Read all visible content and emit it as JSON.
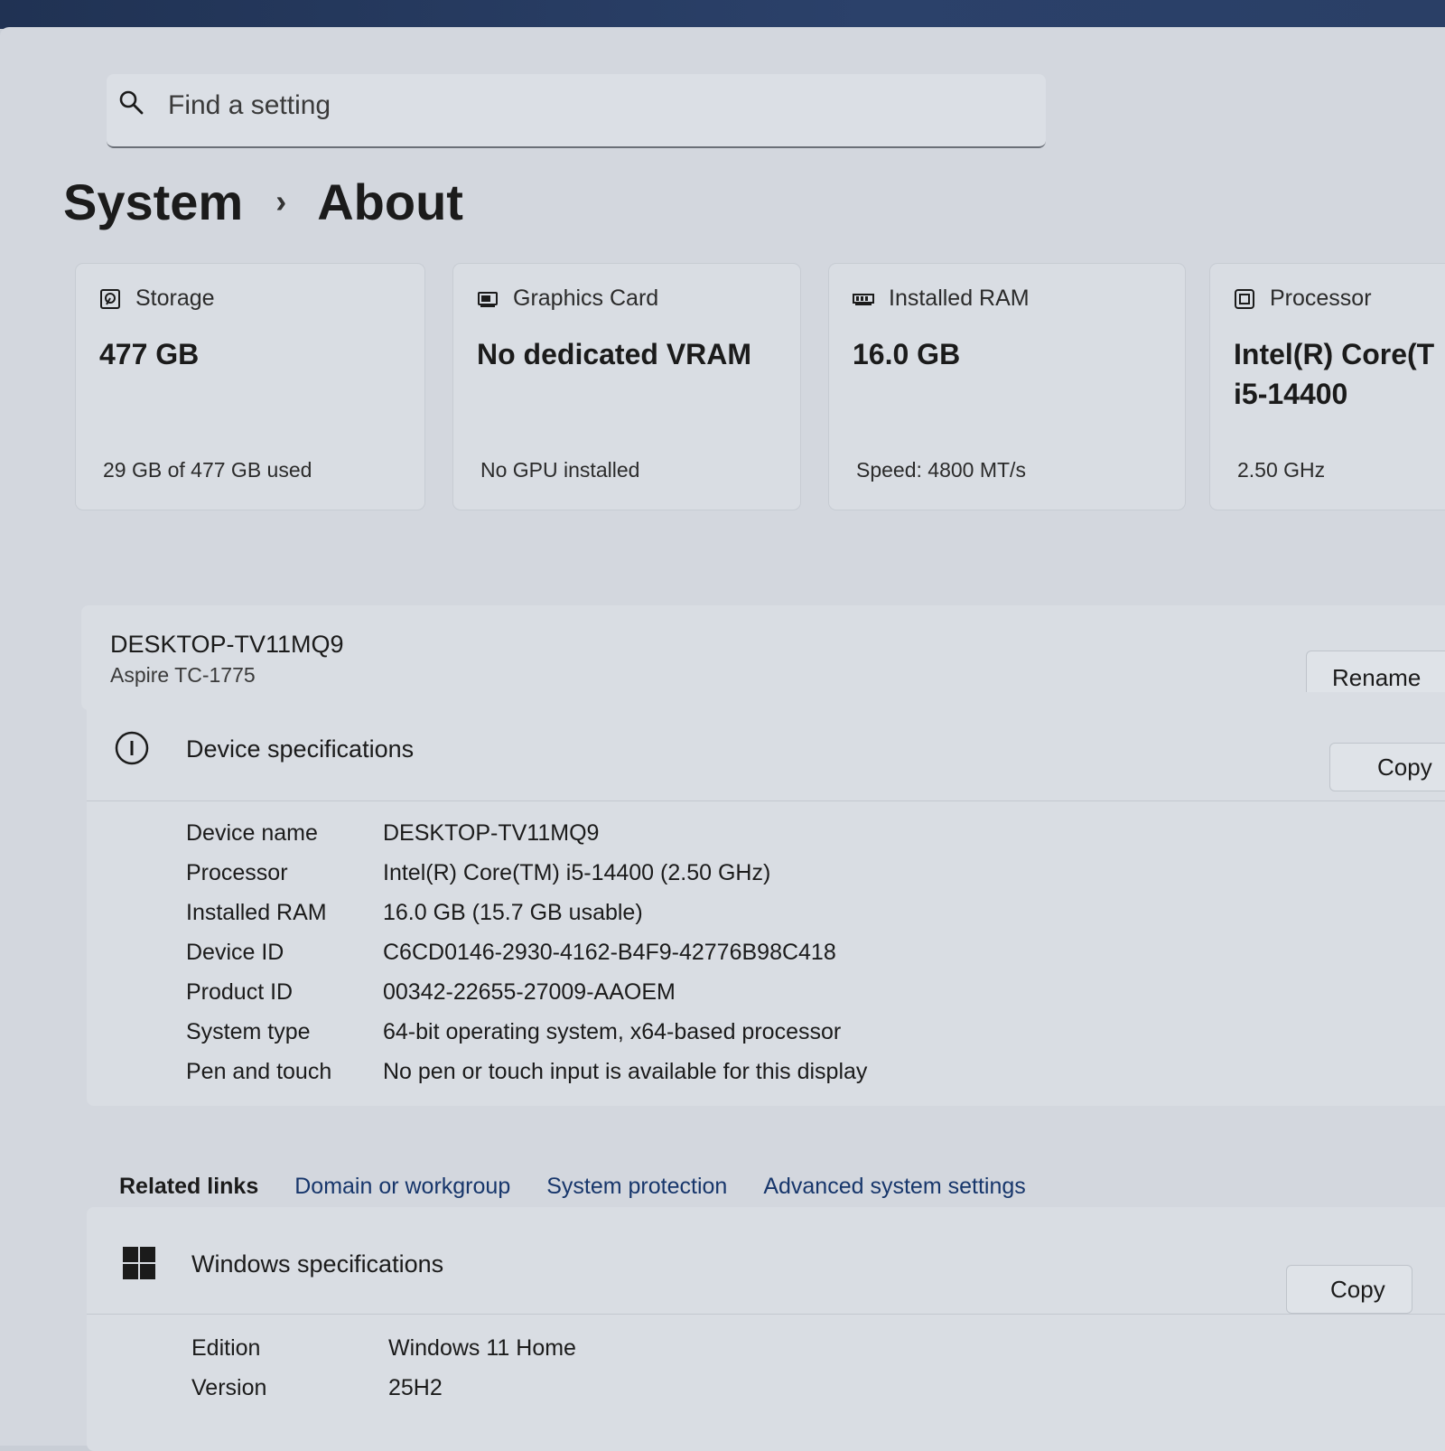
{
  "search": {
    "placeholder": "Find a setting"
  },
  "breadcrumb": {
    "parent": "System",
    "separator": "›",
    "current": "About"
  },
  "cards": [
    {
      "icon": "storage-icon",
      "label": "Storage",
      "value": "477 GB",
      "value2": "",
      "sub": "29 GB of 477 GB used"
    },
    {
      "icon": "graphics-card-icon",
      "label": "Graphics Card",
      "value": "No dedicated VRAM",
      "value2": "",
      "sub": "No GPU installed"
    },
    {
      "icon": "ram-icon",
      "label": "Installed RAM",
      "value": "16.0 GB",
      "value2": "",
      "sub": "Speed: 4800 MT/s"
    },
    {
      "icon": "processor-icon",
      "label": "Processor",
      "value": "Intel(R) Core(T",
      "value2": "i5-14400",
      "sub": "2.50 GHz"
    }
  ],
  "device": {
    "name": "DESKTOP-TV11MQ9",
    "model": "Aspire TC-1775",
    "rename_label": "Rename"
  },
  "device_specs": {
    "title": "Device specifications",
    "copy_label": "Copy",
    "rows": [
      {
        "label": "Device name",
        "value": "DESKTOP-TV11MQ9"
      },
      {
        "label": "Processor",
        "value": "Intel(R) Core(TM) i5-14400 (2.50 GHz)"
      },
      {
        "label": "Installed RAM",
        "value": "16.0 GB (15.7 GB usable)"
      },
      {
        "label": "Device ID",
        "value": "C6CD0146-2930-4162-B4F9-42776B98C418"
      },
      {
        "label": "Product ID",
        "value": "00342-22655-27009-AAOEM"
      },
      {
        "label": "System type",
        "value": "64-bit operating system, x64-based processor"
      },
      {
        "label": "Pen and touch",
        "value": "No pen or touch input is available for this display"
      }
    ]
  },
  "related_links": {
    "title": "Related links",
    "links": [
      "Domain or workgroup",
      "System protection",
      "Advanced system settings"
    ]
  },
  "windows_specs": {
    "title": "Windows specifications",
    "copy_label": "Copy",
    "rows": [
      {
        "label": "Edition",
        "value": "Windows 11 Home"
      },
      {
        "label": "Version",
        "value": "25H2"
      }
    ]
  },
  "colors": {
    "accent": "#17366b",
    "background": "#d3d7de",
    "card": "#d9dde3"
  }
}
